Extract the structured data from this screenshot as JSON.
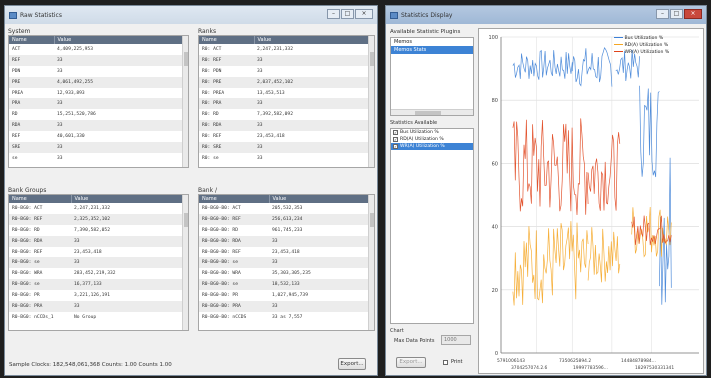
{
  "window1": {
    "title": "Raw Statistics",
    "system": {
      "label": "System",
      "columns": [
        "Name",
        "Value"
      ],
      "rows": [
        [
          "ACT",
          "4,409,225,953"
        ],
        [
          "REF",
          "33"
        ],
        [
          "PDN",
          "33"
        ],
        [
          "PRE",
          "4,061,492,255"
        ],
        [
          "PREA",
          "12,933,893"
        ],
        [
          "PRA",
          "33"
        ],
        [
          "RD",
          "15,251,520,786"
        ],
        [
          "RDA",
          "33"
        ],
        [
          "REF",
          "40,601,330"
        ],
        [
          "SRE",
          "33"
        ],
        [
          "se",
          "33"
        ]
      ]
    },
    "ranks": {
      "label": "Ranks",
      "columns": [
        "Name",
        "Value"
      ],
      "rows": [
        [
          "R0: ACT",
          "2,247,231,332"
        ],
        [
          "R0: REF",
          "33"
        ],
        [
          "R0: PDN",
          "33"
        ],
        [
          "R0: PRE",
          "2,037,452,102"
        ],
        [
          "R0: PREA",
          "13,453,513"
        ],
        [
          "R0: PRA",
          "33"
        ],
        [
          "R0: RD",
          "7,392,582,092"
        ],
        [
          "R0: RDA",
          "33"
        ],
        [
          "R0: REF",
          "23,453,418"
        ],
        [
          "R0: SRE",
          "33"
        ],
        [
          "R0: se",
          "33"
        ]
      ]
    },
    "bank_groups": {
      "label": "Bank Groups",
      "columns": [
        "Name",
        "Value"
      ],
      "rows": [
        [
          "R0-BG0: ACT",
          "2,247,231,332"
        ],
        [
          "R0-BG0: REF",
          "2,325,352,102"
        ],
        [
          "R0-BG0: RD",
          "7,390,582,052"
        ],
        [
          "R0-BG0: RDA",
          "33"
        ],
        [
          "R0-BG0: REF",
          "23,453,418"
        ],
        [
          "R0-BG0: se",
          "33"
        ],
        [
          "R0-BG0: WRA",
          "283,452,219,332"
        ],
        [
          "R0-BG0: se",
          "16,377,133"
        ],
        [
          "R0-BG0: PR",
          "3,221,126,191"
        ],
        [
          "R0-BG0: PRA",
          "33"
        ],
        [
          "R0-BG0: nCCDs_1",
          "No Group"
        ]
      ]
    },
    "bank": {
      "label": "Bank /",
      "columns": [
        "Name",
        "Value"
      ],
      "rows": [
        [
          "R0-BG0-B0: ACT",
          "205,532,353"
        ],
        [
          "R0-BG0-B0: REF",
          "256,613,234"
        ],
        [
          "R0-BG0-B0: RD",
          "961,745,233"
        ],
        [
          "R0-BG0-B0: RDA",
          "33"
        ],
        [
          "R0-BG0-B0: REF",
          "23,453,418"
        ],
        [
          "R0-BG0-B0: se",
          "33"
        ],
        [
          "R0-BG0-B0: WRA",
          "35,303,305,235"
        ],
        [
          "R0-BG0-B0: se",
          "18,532,133"
        ],
        [
          "R0-BG0-B0: PR",
          "1,027,945,739"
        ],
        [
          "R0-BG0-B0: PRA",
          "33"
        ],
        [
          "R0-BG0-B0: nCCDS",
          "33 as 7,557"
        ]
      ]
    },
    "footer": {
      "status": "Sample Clocks: 182,548,061,368    Counts: 1.00    Counts 1.00",
      "export_label": "Export..."
    }
  },
  "window2": {
    "title": "Statistics Display",
    "plugins_label": "Available Statistic Plugins",
    "plugins": [
      "Memos",
      "Memos Stats"
    ],
    "stats_available_label": "Statistics Available",
    "stats": [
      {
        "label": "Bus Utilization %",
        "checked": true
      },
      {
        "label": "RD(A) Utilization %",
        "checked": true
      },
      {
        "label": "WR(A) Utilization %",
        "checked": true
      }
    ],
    "chart_label": "Chart",
    "max_points_label": "Max Data Points",
    "max_points_value": "1000",
    "export_label": "Export...",
    "print_label": "Print",
    "colors": {
      "bus": "#3c7fd6",
      "rd": "#f5a623",
      "wr": "#e0431a"
    }
  },
  "chart_data": {
    "type": "line",
    "ylim": [
      0,
      100
    ],
    "yticks": [
      0,
      20,
      40,
      60,
      80,
      100
    ],
    "ytick_labels": [
      "0",
      "20",
      "40",
      "60",
      "80",
      "100"
    ],
    "xtick_labels": [
      "5791006143",
      "7350625894.2",
      "14484878984...",
      "3704257074.2.6",
      "19997783596...",
      "18297530331341"
    ],
    "series": [
      {
        "name": "Bus Utilization %",
        "color": "#3c7fd6",
        "segments": [
          {
            "x0": 0.06,
            "x1": 0.36,
            "lo": 86,
            "hi": 96
          },
          {
            "x0": 0.36,
            "x1": 0.56,
            "lo": 84,
            "hi": 97
          },
          {
            "x0": 0.58,
            "x1": 0.7,
            "lo": 86,
            "hi": 96
          },
          {
            "x0": 0.7,
            "x1": 0.8,
            "lo": 55,
            "hi": 88
          },
          {
            "x0": 0.8,
            "x1": 0.86,
            "lo": 12,
            "hi": 75
          }
        ]
      },
      {
        "name": "RD(A) Utilization %",
        "color": "#f5a623",
        "segments": [
          {
            "x0": 0.06,
            "x1": 0.44,
            "lo": 15,
            "hi": 42
          },
          {
            "x0": 0.44,
            "x1": 0.6,
            "lo": 22,
            "hi": 40
          },
          {
            "x0": 0.66,
            "x1": 0.86,
            "lo": 30,
            "hi": 48
          }
        ]
      },
      {
        "name": "WR(A) Utilization %",
        "color": "#e0431a",
        "segments": [
          {
            "x0": 0.06,
            "x1": 0.44,
            "lo": 42,
            "hi": 75
          },
          {
            "x0": 0.44,
            "x1": 0.6,
            "lo": 45,
            "hi": 70
          },
          {
            "x0": 0.66,
            "x1": 0.86,
            "lo": 34,
            "hi": 44
          }
        ]
      }
    ],
    "legend": "top-right",
    "grid": true
  }
}
